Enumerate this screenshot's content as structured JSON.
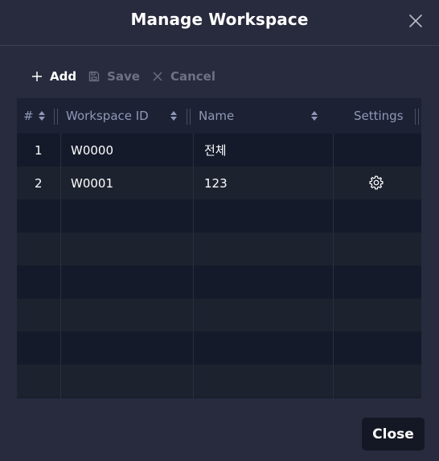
{
  "dialog": {
    "title": "Manage Workspace"
  },
  "toolbar": {
    "add_label": "Add",
    "save_label": "Save",
    "cancel_label": "Cancel"
  },
  "table": {
    "columns": [
      "#",
      "Workspace ID",
      "Name",
      "Settings"
    ],
    "rows": [
      {
        "num": "1",
        "workspace_id": "W0000",
        "name": "전체",
        "has_settings": false
      },
      {
        "num": "2",
        "workspace_id": "W0001",
        "name": "123",
        "has_settings": true
      }
    ]
  },
  "footer": {
    "close_label": "Close"
  },
  "icons": {
    "add": "plus-icon",
    "save": "save-icon",
    "cancel": "x-icon",
    "settings": "gear-icon",
    "close": "close-icon",
    "sort": "sort-icon"
  }
}
